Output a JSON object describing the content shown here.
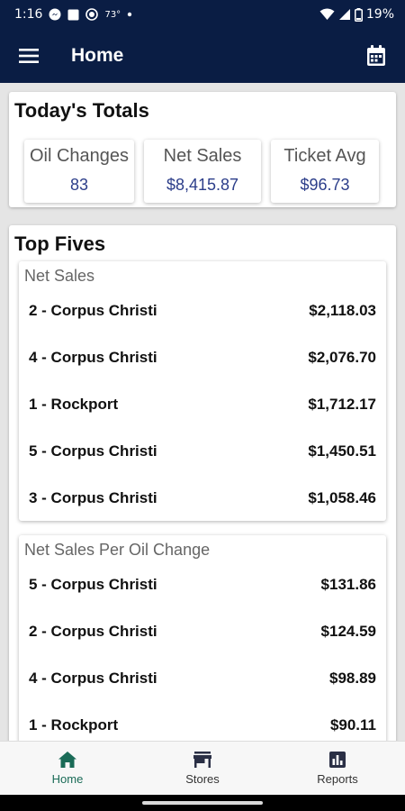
{
  "status": {
    "time": "1:16",
    "temperature": "73°",
    "battery": "19%"
  },
  "header": {
    "title": "Home"
  },
  "totals": {
    "title": "Today's Totals",
    "stats": [
      {
        "label": "Oil Changes",
        "value": "83"
      },
      {
        "label": "Net Sales",
        "value": "$8,415.87"
      },
      {
        "label": "Ticket Avg",
        "value": "$96.73"
      }
    ]
  },
  "top_fives": {
    "title": "Top Fives",
    "sections": [
      {
        "title": "Net Sales",
        "rows": [
          {
            "store": "2 - Corpus Christi",
            "value": "$2,118.03"
          },
          {
            "store": "4 - Corpus Christi",
            "value": "$2,076.70"
          },
          {
            "store": "1 - Rockport",
            "value": "$1,712.17"
          },
          {
            "store": "5 - Corpus Christi",
            "value": "$1,450.51"
          },
          {
            "store": "3 - Corpus Christi",
            "value": "$1,058.46"
          }
        ]
      },
      {
        "title": "Net Sales Per Oil Change",
        "rows": [
          {
            "store": "5 - Corpus Christi",
            "value": "$131.86"
          },
          {
            "store": "2 - Corpus Christi",
            "value": "$124.59"
          },
          {
            "store": "4 - Corpus Christi",
            "value": "$98.89"
          },
          {
            "store": "1 - Rockport",
            "value": "$90.11"
          }
        ]
      }
    ]
  },
  "nav": [
    {
      "label": "Home",
      "icon": "home-icon",
      "active": true
    },
    {
      "label": "Stores",
      "icon": "store-icon",
      "active": false
    },
    {
      "label": "Reports",
      "icon": "reports-icon",
      "active": false
    }
  ],
  "colors": {
    "header_bg": "#0a1d44",
    "value_blue": "#2c3e8a",
    "nav_active": "#1a6b57"
  }
}
